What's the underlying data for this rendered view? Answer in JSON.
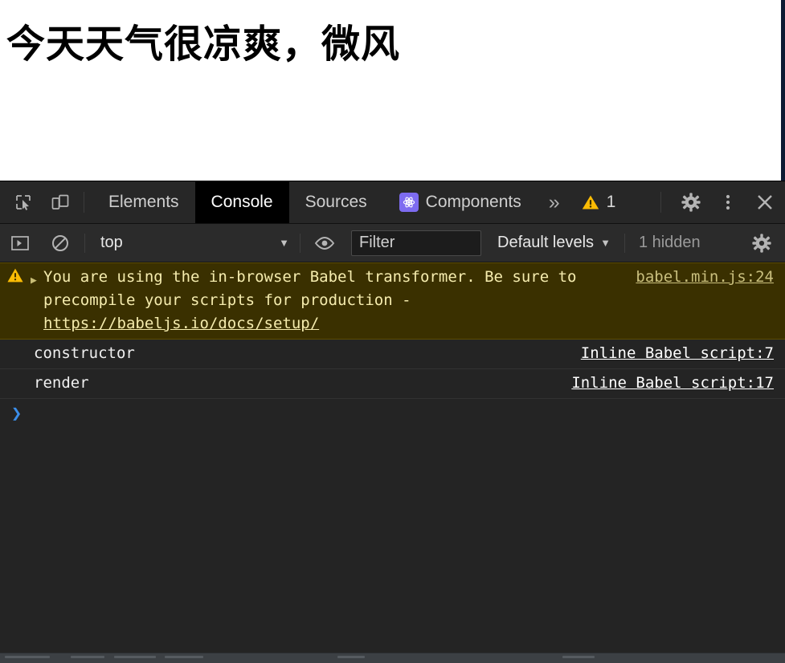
{
  "page": {
    "heading": "今天天气很凉爽，微风"
  },
  "devtools": {
    "toolbar": {
      "inspect_icon": "inspect-element-icon",
      "device_icon": "device-toolbar-icon",
      "tabs": [
        {
          "label": "Elements",
          "active": false,
          "icon": null
        },
        {
          "label": "Console",
          "active": true,
          "icon": null
        },
        {
          "label": "Sources",
          "active": false,
          "icon": null
        },
        {
          "label": "Components",
          "active": false,
          "icon": "react-atom-icon"
        }
      ],
      "overflow_label": "»",
      "warning_count": "1",
      "settings_icon": "gear-icon",
      "more_icon": "kebab-menu-icon",
      "close_icon": "close-icon"
    },
    "console_toolbar": {
      "sidebar_icon": "console-sidebar-icon",
      "clear_icon": "clear-console-icon",
      "context": "top",
      "context_caret": "▼",
      "eye_icon": "live-expression-eye-icon",
      "filter_placeholder": "Filter",
      "filter_value": "",
      "levels_label": "Default levels",
      "levels_caret": "▼",
      "hidden_label": "1 hidden",
      "settings_icon": "console-settings-gear-icon"
    },
    "messages": [
      {
        "level": "warning",
        "icon": "warning-triangle-icon",
        "expander": "▶",
        "text_before_link": "You are using the in-browser Babel transformer. Be sure to precompile your scripts for production - ",
        "link_text": "https://babeljs.io/docs/setup/",
        "source": "babel.min.js:24"
      },
      {
        "level": "log",
        "text": "constructor",
        "source": "Inline Babel script:7"
      },
      {
        "level": "log",
        "text": "render",
        "source": "Inline Babel script:17"
      }
    ],
    "prompt": {
      "chevron": "❯",
      "value": ""
    }
  },
  "colors": {
    "warning_bg": "#3a3000",
    "warning_text": "#f5ecae",
    "accent_blue": "#3b8eea",
    "react_purple": "#7d6bf0",
    "warning_yellow": "#fbbc04",
    "devtools_bg": "#242424",
    "active_tab_bg": "#000000"
  }
}
